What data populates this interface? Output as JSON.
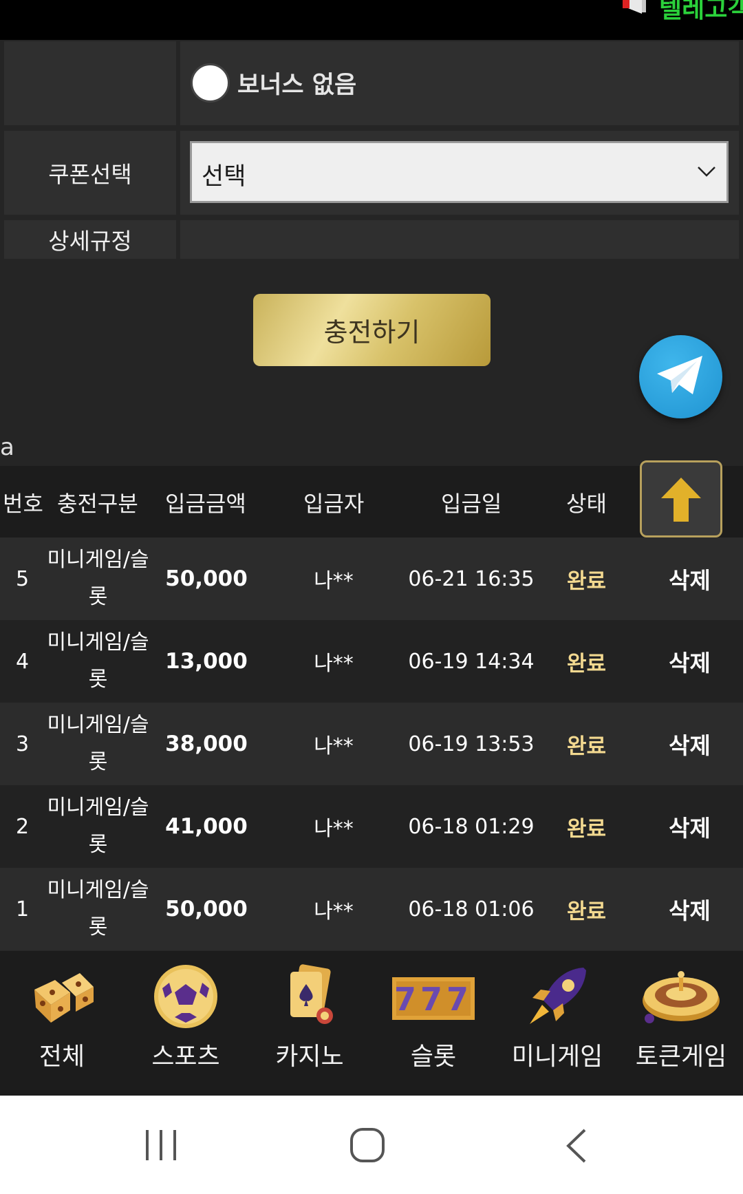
{
  "top_marquee": {
    "text": "텔레고객"
  },
  "bonus_row": {
    "radio_label": "보너스 없음"
  },
  "coupon_row": {
    "label": "쿠폰선택",
    "select_value": "선택"
  },
  "rules_row": {
    "label": "상세규정"
  },
  "charge_button": {
    "label": "충전하기"
  },
  "stray_text": "a",
  "table": {
    "headers": [
      "번호",
      "충전구분",
      "입금금액",
      "입금자",
      "입금일",
      "상태"
    ],
    "rows": [
      {
        "num": "5",
        "type_line1": "미니게임/슬",
        "type_line2": "롯",
        "amount": "50,000",
        "depositor": "나**",
        "date": "06-21 16:35",
        "status": "완료",
        "action": "삭제"
      },
      {
        "num": "4",
        "type_line1": "미니게임/슬",
        "type_line2": "롯",
        "amount": "13,000",
        "depositor": "나**",
        "date": "06-19 14:34",
        "status": "완료",
        "action": "삭제"
      },
      {
        "num": "3",
        "type_line1": "미니게임/슬",
        "type_line2": "롯",
        "amount": "38,000",
        "depositor": "나**",
        "date": "06-19 13:53",
        "status": "완료",
        "action": "삭제"
      },
      {
        "num": "2",
        "type_line1": "미니게임/슬",
        "type_line2": "롯",
        "amount": "41,000",
        "depositor": "나**",
        "date": "06-18 01:29",
        "status": "완료",
        "action": "삭제"
      },
      {
        "num": "1",
        "type_line1": "미니게임/슬",
        "type_line2": "롯",
        "amount": "50,000",
        "depositor": "나**",
        "date": "06-18 01:06",
        "status": "완료",
        "action": "삭제"
      }
    ]
  },
  "bottom_nav": [
    {
      "label": "전체",
      "icon": "dice-icon"
    },
    {
      "label": "스포츠",
      "icon": "soccer-ball-icon"
    },
    {
      "label": "카지노",
      "icon": "playing-cards-icon"
    },
    {
      "label": "슬롯",
      "icon": "slot-777-icon"
    },
    {
      "label": "미니게임",
      "icon": "rocket-icon"
    },
    {
      "label": "토큰게임",
      "icon": "roulette-icon"
    }
  ],
  "colors": {
    "background": "#252525",
    "status_complete": "#f3d990",
    "gold_button": "#e6d48a",
    "marquee": "#2bd13b",
    "telegram": "#2aa3dc"
  }
}
